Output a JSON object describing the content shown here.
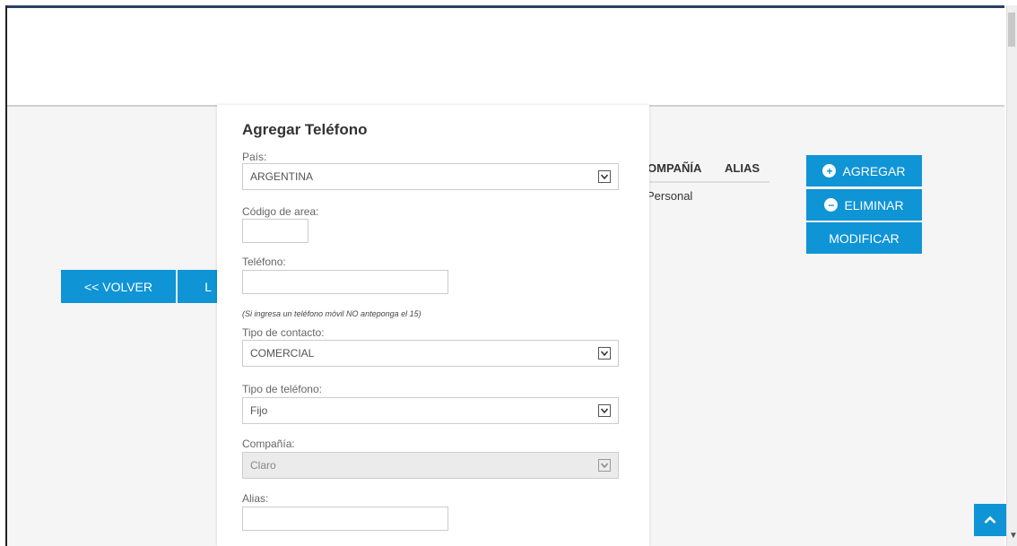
{
  "colors": {
    "primary": "#0f94d6",
    "header_line": "#2b3e66"
  },
  "background": {
    "volver_label": "<< VOLVER",
    "hidden_button_label": "L",
    "table_headers": [
      "OMPAÑÍA",
      "ALIAS"
    ],
    "table_row_company": "Personal"
  },
  "actions": {
    "add_label": "AGREGAR",
    "delete_label": "ELIMINAR",
    "modify_label": "MODIFICAR"
  },
  "modal": {
    "title": "Agregar Teléfono",
    "pais_label": "País:",
    "pais_value": "ARGENTINA",
    "area_label": "Código de area:",
    "area_value": "",
    "phone_label": "Teléfono:",
    "phone_value": "",
    "hint": "(Si ingresa un teléfono móvil NO anteponga el 15)",
    "contact_type_label": "Tipo de contacto:",
    "contact_type_value": "COMERCIAL",
    "phone_type_label": "Tipo de teléfono:",
    "phone_type_value": "Fijo",
    "company_label": "Compañía:",
    "company_value": "Claro",
    "alias_label": "Alias:",
    "alias_value": ""
  },
  "icons": {
    "plus": "plus-circle-icon",
    "minus": "minus-circle-icon",
    "dropdown": "chevron-down-icon",
    "scroll_top": "chevron-up-icon"
  }
}
